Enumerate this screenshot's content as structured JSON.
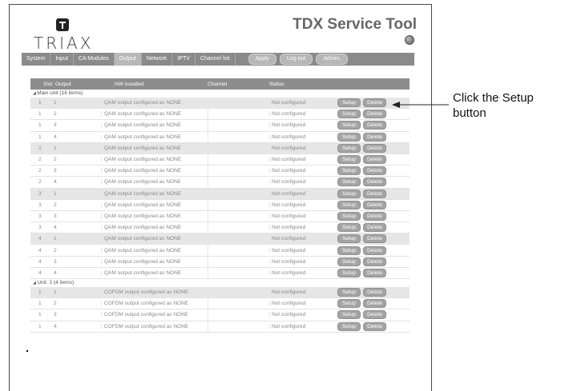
{
  "brand": {
    "logo_text": "TRIAX",
    "app_title": "TDX Service Tool"
  },
  "nav": {
    "tabs": [
      "System",
      "Input",
      "CA Modules",
      "Output",
      "Network",
      "IPTV",
      "Channel list"
    ],
    "active": "Output",
    "buttons": [
      "Apply",
      "Log out",
      "Admin."
    ]
  },
  "table": {
    "headers": {
      "slot": "Slot",
      "output": "Output",
      "hw": "HW installed",
      "channel": "Channel",
      "status": "Status"
    },
    "groups": [
      {
        "label": "Main unit (16 items)",
        "rows": [
          {
            "slot": "1",
            "output": "1",
            "hw": "QAM output configured as NONE",
            "status": "Not configured"
          },
          {
            "slot": "1",
            "output": "2",
            "hw": "QAM output configured as NONE",
            "status": "Not configured"
          },
          {
            "slot": "1",
            "output": "3",
            "hw": "QAM output configured as NONE",
            "status": "Not configured"
          },
          {
            "slot": "1",
            "output": "4",
            "hw": "QAM output configured as NONE",
            "status": "Not configured"
          },
          {
            "slot": "2",
            "output": "1",
            "hw": "QAM output configured as NONE",
            "status": "Not configured"
          },
          {
            "slot": "2",
            "output": "2",
            "hw": "QAM output configured as NONE",
            "status": "Not configured"
          },
          {
            "slot": "2",
            "output": "3",
            "hw": "QAM output configured as NONE",
            "status": "Not configured"
          },
          {
            "slot": "2",
            "output": "4",
            "hw": "QAM output configured as NONE",
            "status": "Not configured"
          },
          {
            "slot": "3",
            "output": "1",
            "hw": "QAM output configured as NONE",
            "status": "Not configured"
          },
          {
            "slot": "3",
            "output": "2",
            "hw": "QAM output configured as NONE",
            "status": "Not configured"
          },
          {
            "slot": "3",
            "output": "3",
            "hw": "QAM output configured as NONE",
            "status": "Not configured"
          },
          {
            "slot": "3",
            "output": "4",
            "hw": "QAM output configured as NONE",
            "status": "Not configured"
          },
          {
            "slot": "4",
            "output": "1",
            "hw": "QAM output configured as NONE",
            "status": "Not configured"
          },
          {
            "slot": "4",
            "output": "2",
            "hw": "QAM output configured as NONE",
            "status": "Not configured"
          },
          {
            "slot": "4",
            "output": "3",
            "hw": "QAM output configured as NONE",
            "status": "Not configured"
          },
          {
            "slot": "4",
            "output": "4",
            "hw": "QAM output configured as NONE",
            "status": "Not configured"
          }
        ]
      },
      {
        "label": "Unit: 1 (4 items)",
        "rows": [
          {
            "slot": "1",
            "output": "1",
            "hw": "COFDM output configured as NONE",
            "status": "Not configured"
          },
          {
            "slot": "1",
            "output": "2",
            "hw": "COFDM output configured as NONE",
            "status": "Not configured"
          },
          {
            "slot": "1",
            "output": "3",
            "hw": "COFDM output configured as NONE",
            "status": "Not configured"
          },
          {
            "slot": "1",
            "output": "4",
            "hw": "COFDM output configured as NONE",
            "status": "Not configured"
          }
        ]
      }
    ],
    "row_buttons": {
      "setup": "Setup",
      "delete": "Delete"
    }
  },
  "callout": {
    "line1": "Click the Setup",
    "line2": "button"
  },
  "colors": {
    "navbar": "#8a8a8a",
    "header": "#8d8d8d",
    "button": "#a4a4a4",
    "alt_row": "#e6e6e6"
  }
}
